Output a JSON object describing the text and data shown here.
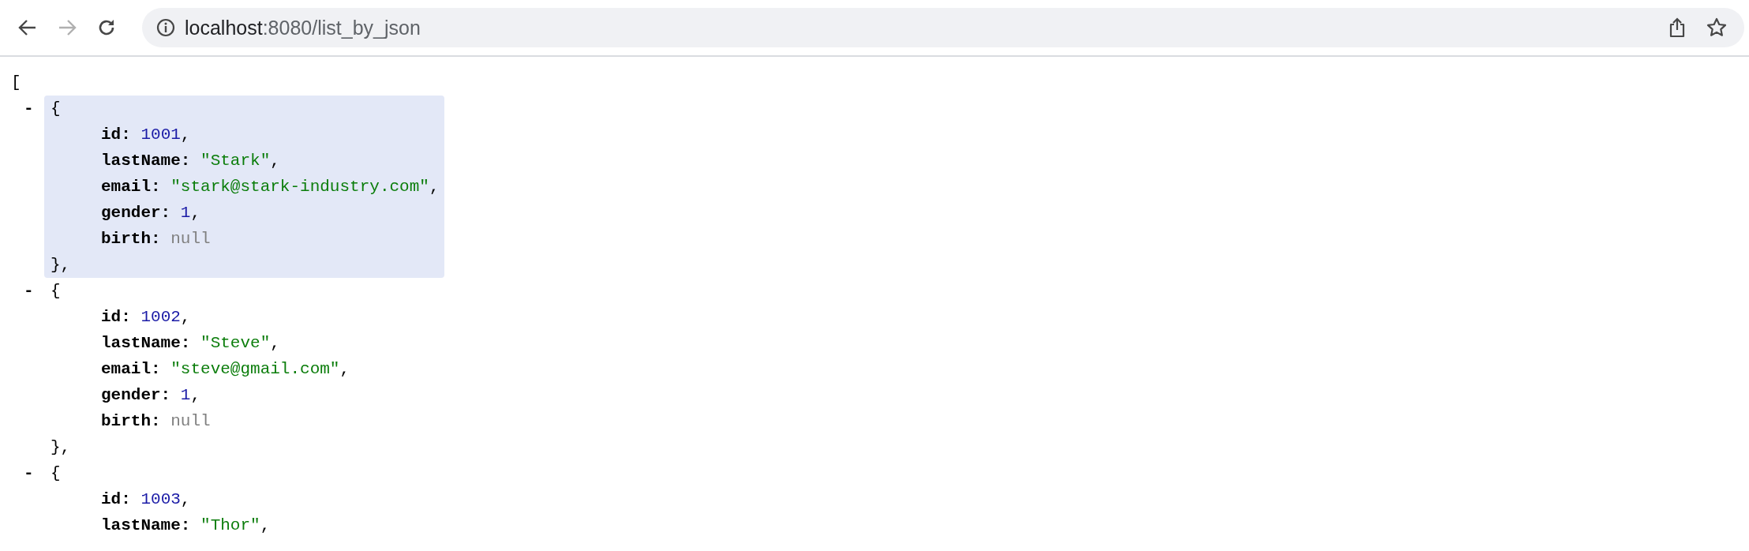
{
  "toolbar": {
    "back": {
      "disabled": false
    },
    "forward": {
      "disabled": true
    },
    "address": {
      "host": "localhost",
      "rest": ":8080/list_by_json"
    }
  },
  "json_view": {
    "open": "[",
    "items": [
      {
        "toggle": "-",
        "open": "{",
        "close": "},",
        "highlighted": true,
        "fields": [
          {
            "key": "id:",
            "value": "1001",
            "kind": "number",
            "punct": ","
          },
          {
            "key": "lastName:",
            "value": "\"Stark\"",
            "kind": "string",
            "punct": ","
          },
          {
            "key": "email:",
            "value": "\"stark@stark-industry.com\"",
            "kind": "string",
            "punct": ","
          },
          {
            "key": "gender:",
            "value": "1",
            "kind": "number",
            "punct": ","
          },
          {
            "key": "birth:",
            "value": "null",
            "kind": "null"
          }
        ]
      },
      {
        "toggle": "-",
        "open": "{",
        "close": "},",
        "highlighted": false,
        "fields": [
          {
            "key": "id:",
            "value": "1002",
            "kind": "number",
            "punct": ","
          },
          {
            "key": "lastName:",
            "value": "\"Steve\"",
            "kind": "string",
            "punct": ","
          },
          {
            "key": "email:",
            "value": "\"steve@gmail.com\"",
            "kind": "string",
            "punct": ","
          },
          {
            "key": "gender:",
            "value": "1",
            "kind": "number",
            "punct": ","
          },
          {
            "key": "birth:",
            "value": "null",
            "kind": "null"
          }
        ]
      },
      {
        "toggle": "-",
        "open": "{",
        "highlighted": false,
        "fields": [
          {
            "key": "id:",
            "value": "1003",
            "kind": "number",
            "punct": ","
          },
          {
            "key": "lastName:",
            "value": "\"Thor\"",
            "kind": "string",
            "punct": ","
          }
        ]
      }
    ]
  }
}
